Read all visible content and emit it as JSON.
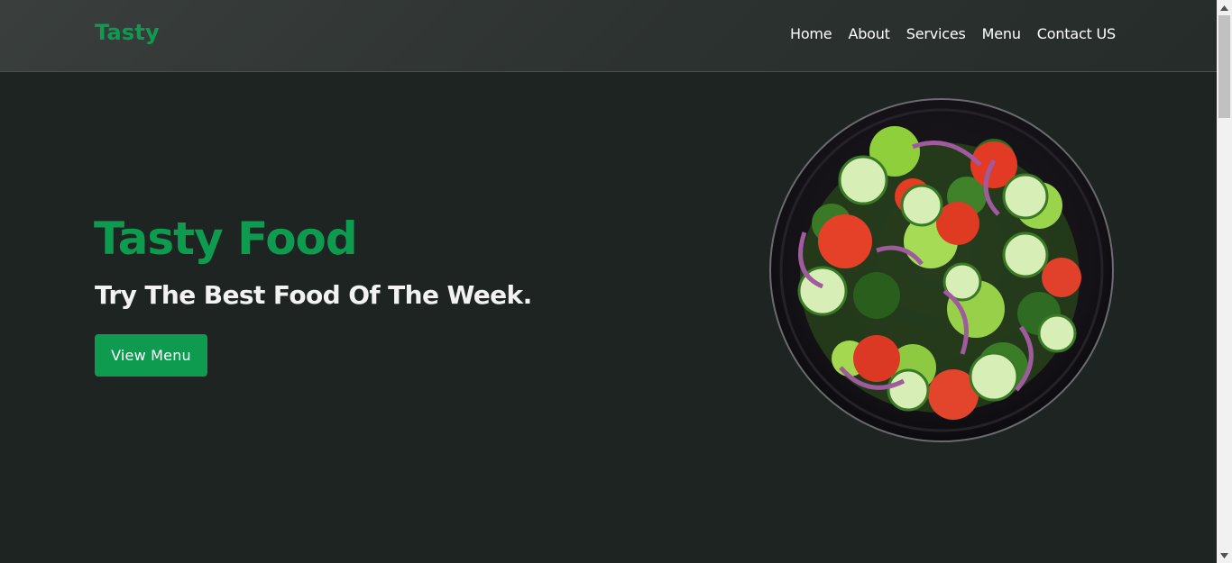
{
  "header": {
    "logo": "Tasty",
    "nav": [
      {
        "label": "Home"
      },
      {
        "label": "About"
      },
      {
        "label": "Services"
      },
      {
        "label": "Menu"
      },
      {
        "label": "Contact US"
      }
    ]
  },
  "hero": {
    "title": "Tasty Food",
    "subtitle": "Try The Best Food Of The Week.",
    "button_label": "View Menu",
    "image_subject": "salad-bowl"
  },
  "colors": {
    "brand_green": "#0e9a4f",
    "background": "#1d2421",
    "header_bg": "#2c3230",
    "text_light": "#f2f2f2"
  },
  "icons": {
    "scroll_up": "scroll-up-arrow-icon",
    "scroll_down": "scroll-down-arrow-icon"
  }
}
